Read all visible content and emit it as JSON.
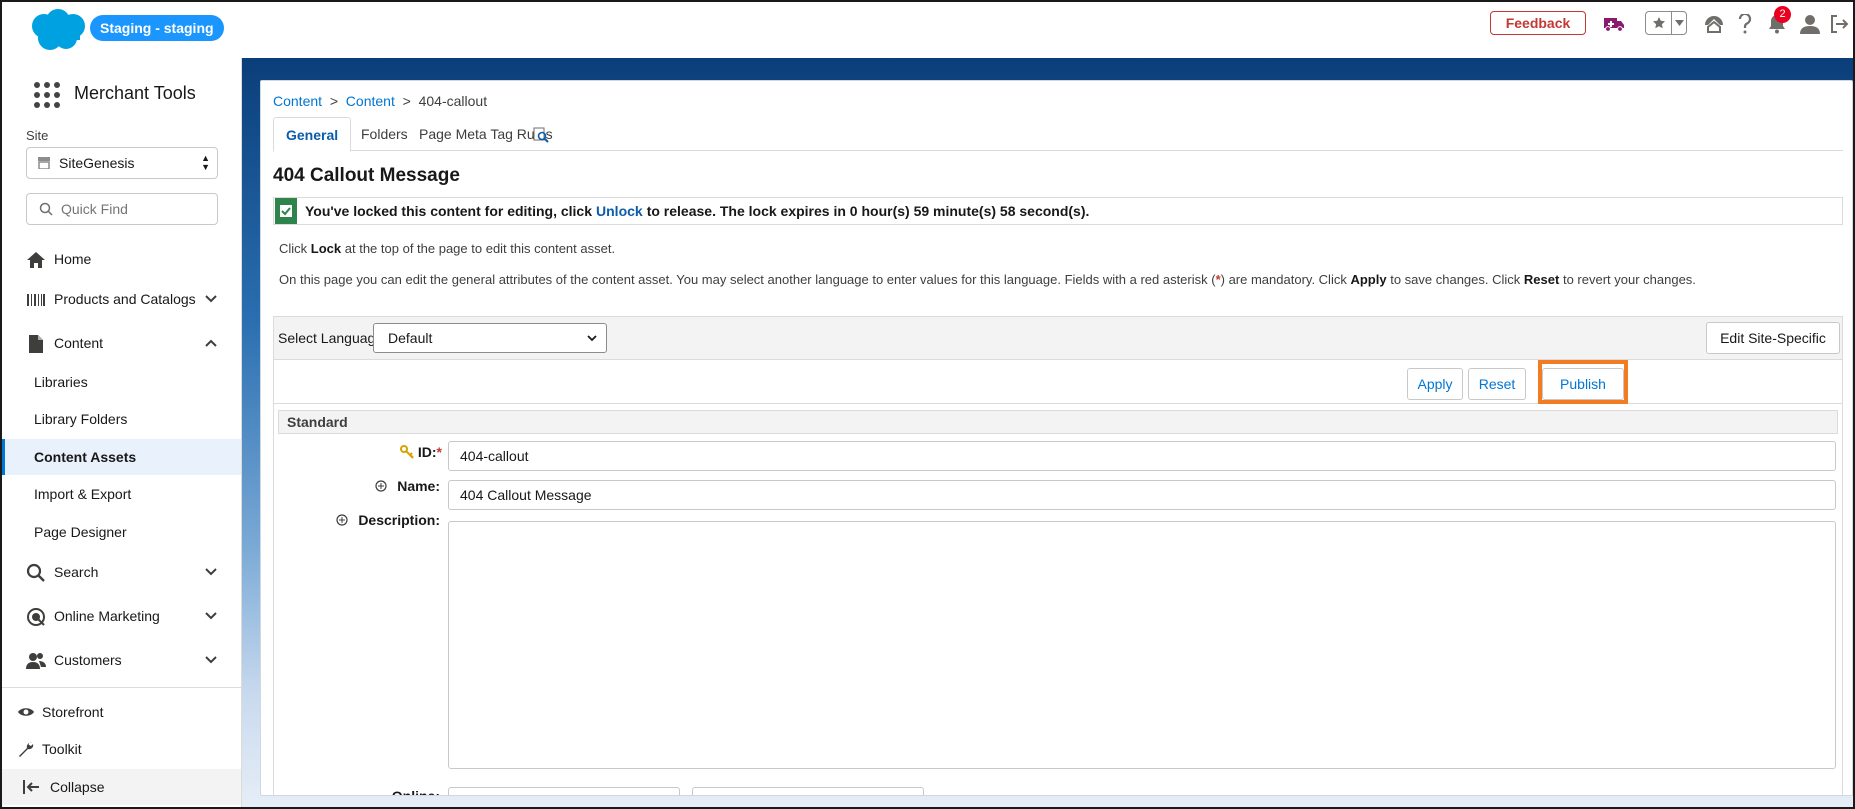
{
  "header": {
    "env_label": "Staging - staging",
    "feedback_label": "Feedback",
    "notification_count": "2",
    "colors": {
      "brand": "#00a1e0",
      "env_pill": "#1b96ff",
      "feedback": "#c23934",
      "highlight": "#f27c22"
    }
  },
  "sidebar": {
    "app_name": "Merchant Tools",
    "site_label": "Site",
    "site_value": "SiteGenesis",
    "quickfind_placeholder": "Quick Find",
    "items": [
      {
        "label": "Home",
        "icon": "home-icon"
      },
      {
        "label": "Products and Catalogs",
        "icon": "barcode-icon"
      },
      {
        "label": "Content",
        "icon": "document-icon"
      },
      {
        "label": "Search",
        "icon": "search-icon"
      },
      {
        "label": "Online Marketing",
        "icon": "marketing-icon"
      },
      {
        "label": "Customers",
        "icon": "customers-icon"
      }
    ],
    "content_children": [
      "Libraries",
      "Library Folders",
      "Content Assets",
      "Import & Export",
      "Page Designer"
    ],
    "active_child": "Content Assets",
    "storefront_label": "Storefront",
    "toolkit_label": "Toolkit",
    "collapse_label": "Collapse"
  },
  "main": {
    "breadcrumb": {
      "crumb1": "Content",
      "crumb2": "Content",
      "current": "404-callout"
    },
    "tabs": [
      "General",
      "Folders",
      "Page Meta Tag Rules"
    ],
    "title": "404 Callout Message",
    "lock_banner": {
      "before": "You've locked this content for editing, click",
      "link": "Unlock",
      "after": "to release. The lock expires in 0 hour(s) 59 minute(s) 58 second(s)."
    },
    "help1": {
      "pre": "Click",
      "bold": "Lock",
      "post": "at the top of the page to edit this content asset."
    },
    "help2": {
      "pre": "On this page you can edit the general attributes of the content asset. You may select another language to enter values for this language. Fields with a red asterisk (",
      "star": "*",
      "mid": ") are mandatory. Click",
      "apply": "Apply",
      "mid2": "to save changes. Click",
      "reset": "Reset",
      "post": "to revert your changes."
    },
    "language": {
      "label": "Select Language:",
      "value": "Default"
    },
    "edit_site_specific": "Edit Site-Specific",
    "actions": {
      "apply": "Apply",
      "reset": "Reset",
      "publish": "Publish"
    },
    "section": "Standard",
    "fields": {
      "id_label": "ID:",
      "id_required": "*",
      "id_value": "404-callout",
      "name_label": "Name:",
      "name_value": "404 Callout Message",
      "description_label": "Description:",
      "description_value": "",
      "online_label": "Online:"
    }
  }
}
